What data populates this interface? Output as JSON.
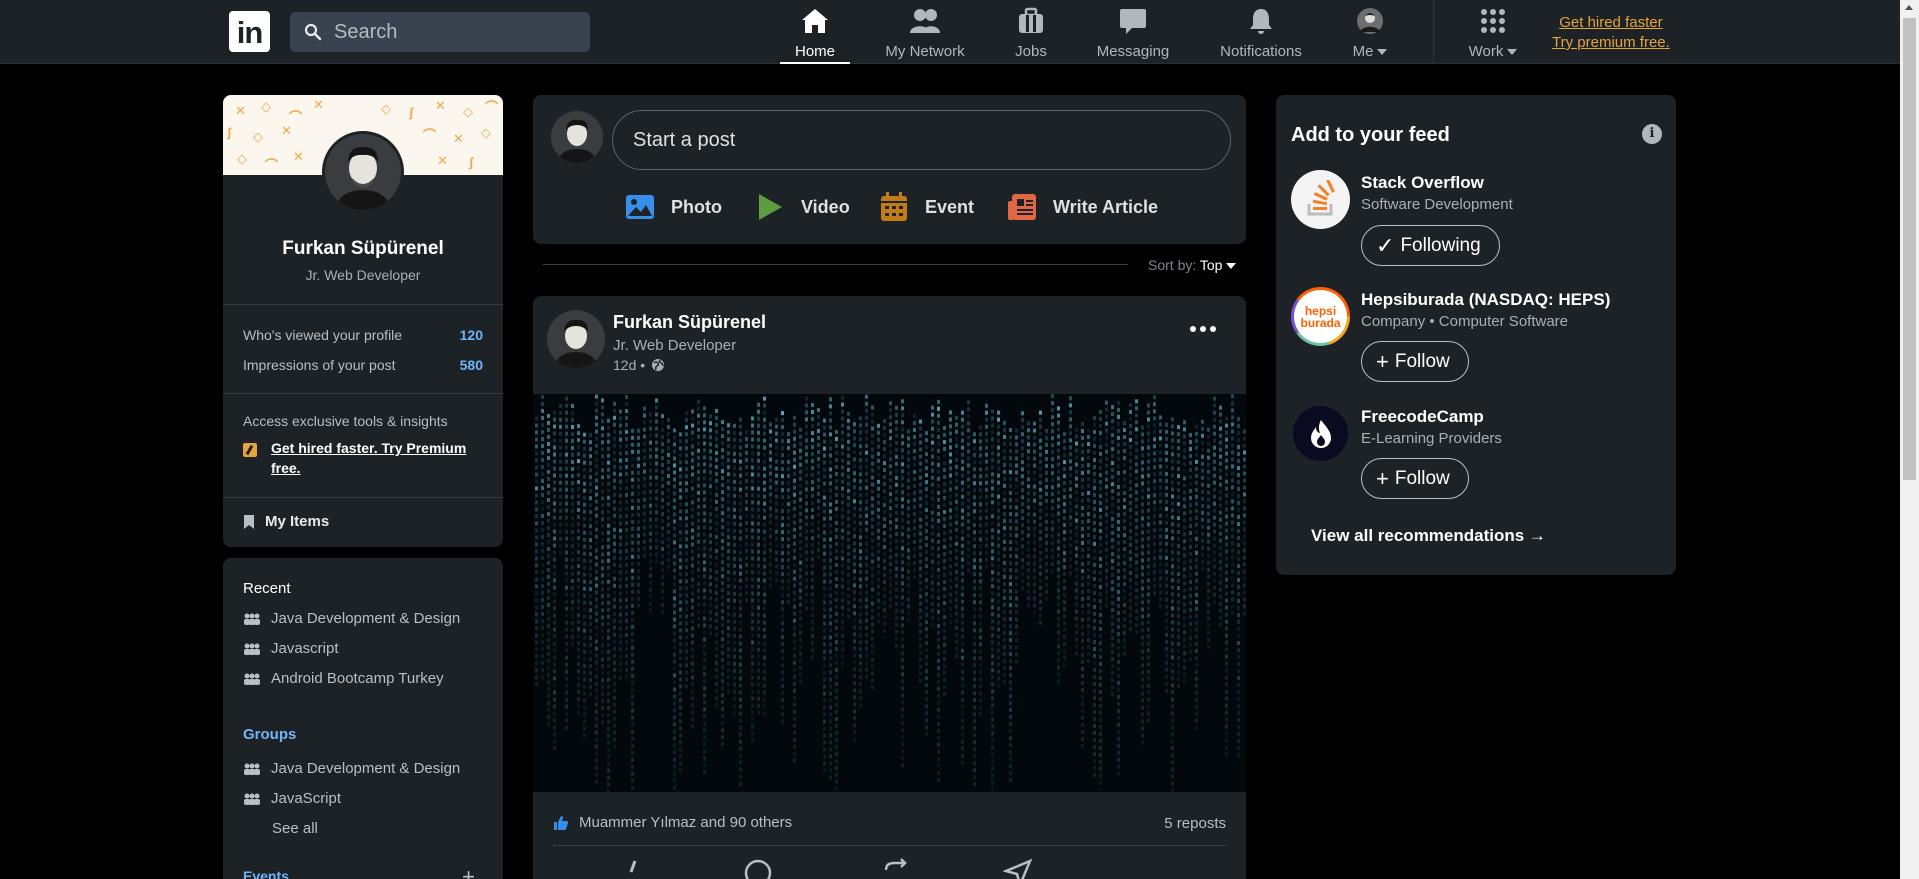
{
  "nav": {
    "logo_text": "in",
    "search_placeholder": "Search",
    "items": [
      {
        "label": "Home",
        "icon": "home-icon",
        "active": true
      },
      {
        "label": "My Network",
        "icon": "network-icon"
      },
      {
        "label": "Jobs",
        "icon": "briefcase-icon"
      },
      {
        "label": "Messaging",
        "icon": "message-icon"
      },
      {
        "label": "Notifications",
        "icon": "bell-icon"
      },
      {
        "label": "Me",
        "icon": "avatar"
      },
      {
        "label": "Work",
        "icon": "grid-icon"
      }
    ],
    "premium_line1": "Get hired faster",
    "premium_line2": "Try premium free."
  },
  "profile": {
    "name": "Furkan Süpürenel",
    "title": "Jr. Web Developer",
    "stats": [
      {
        "label": "Who's viewed your profile",
        "value": "120"
      },
      {
        "label": "Impressions of your post",
        "value": "580"
      }
    ],
    "access_text": "Access exclusive tools & insights",
    "premium_text": "Get hired faster. Try Premium free.",
    "my_items": "My Items"
  },
  "sidebar": {
    "recent_title": "Recent",
    "recent": [
      "Java Development & Design",
      "Javascript",
      "Android Bootcamp Turkey"
    ],
    "groups_title": "Groups",
    "groups": [
      "Java Development & Design",
      "JavaScript"
    ],
    "see_all": "See all",
    "events_title": "Events"
  },
  "composer": {
    "placeholder": "Start a post",
    "actions": [
      {
        "label": "Photo",
        "icon": "photo-icon",
        "color": "#378fe9"
      },
      {
        "label": "Video",
        "icon": "video-icon",
        "color": "#5f9b41"
      },
      {
        "label": "Event",
        "icon": "calendar-icon",
        "color": "#c37d16"
      },
      {
        "label": "Write Article",
        "icon": "article-icon",
        "color": "#e16745"
      }
    ]
  },
  "sort": {
    "label": "Sort by:",
    "value": "Top"
  },
  "post": {
    "author": "Furkan Süpürenel",
    "subtitle": "Jr. Web Developer",
    "time": "12d •",
    "reactions": "Muammer Yılmaz and 90 others",
    "reposts": "5 reposts"
  },
  "feed": {
    "title": "Add to your feed",
    "recommendations": [
      {
        "name": "Stack Overflow",
        "subtitle": "Software Development",
        "button": "Following",
        "button_icon": "check-icon"
      },
      {
        "name": "Hepsiburada (NASDAQ: HEPS)",
        "subtitle": "Company • Computer Software",
        "button": "Follow",
        "button_icon": "plus-icon",
        "logo_text": "hepsi burada"
      },
      {
        "name": "FreecodeCamp",
        "subtitle": "E-Learning Providers",
        "button": "Follow",
        "button_icon": "plus-icon"
      }
    ],
    "view_all": "View all recommendations →"
  },
  "colors": {
    "background": "#000000",
    "card": "#1d2226",
    "accent_blue": "#70b5f9",
    "premium": "#e7a33e"
  }
}
